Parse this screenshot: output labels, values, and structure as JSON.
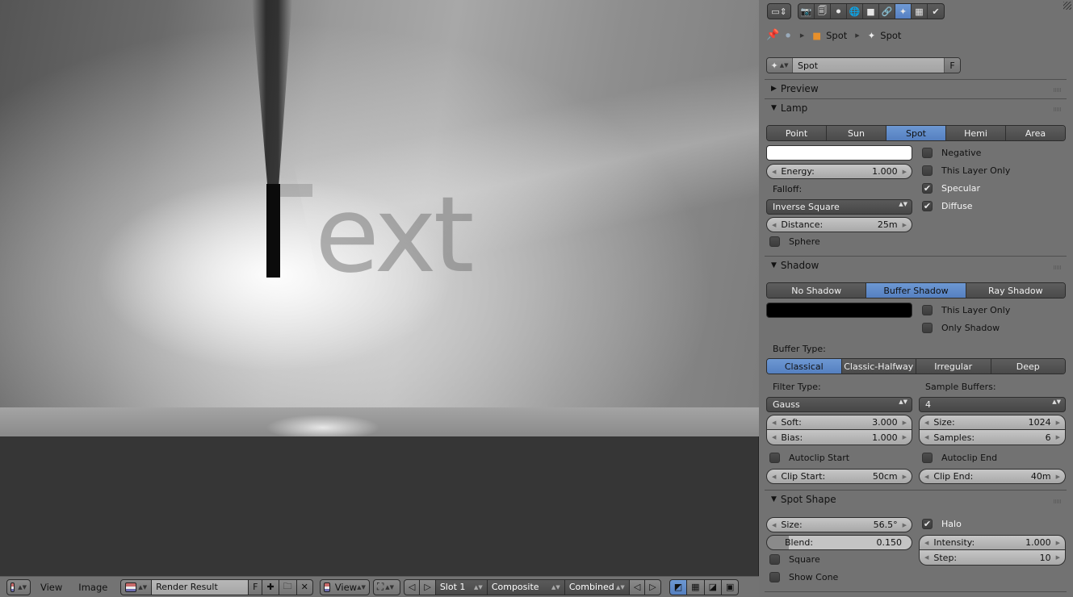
{
  "image_editor": {
    "render_text": "ext",
    "header": {
      "menus": [
        "View",
        "Image"
      ],
      "image_name": "Render Result",
      "fake_user_label": "F",
      "view_label": "View",
      "slot_label": "Slot 1",
      "layer_label": "Composite",
      "pass_label": "Combined"
    }
  },
  "properties": {
    "context_tabs": [
      {
        "name": "render",
        "glyph": "📷"
      },
      {
        "name": "render-layers",
        "glyph": "🗐"
      },
      {
        "name": "scene",
        "glyph": "⚫"
      },
      {
        "name": "world",
        "glyph": "🌐"
      },
      {
        "name": "object",
        "glyph": "■"
      },
      {
        "name": "constraints",
        "glyph": "🔗"
      },
      {
        "name": "data-lamp",
        "glyph": "✦",
        "active": true
      },
      {
        "name": "texture",
        "glyph": "▦"
      },
      {
        "name": "particles",
        "glyph": "✔"
      }
    ],
    "breadcrumb": {
      "object_name": "Spot",
      "lamp_name": "Spot"
    },
    "datablock": {
      "name": "Spot",
      "fake_user": "F"
    },
    "panels": {
      "preview": {
        "title": "Preview",
        "expanded": false
      },
      "lamp": {
        "title": "Lamp",
        "expanded": true,
        "types": [
          "Point",
          "Sun",
          "Spot",
          "Hemi",
          "Area"
        ],
        "selected_type": "Spot",
        "color": "#ffffff",
        "energy_label": "Energy:",
        "energy_value": "1.000",
        "falloff_label": "Falloff:",
        "falloff_value": "Inverse Square",
        "distance_label": "Distance:",
        "distance_value": "25m",
        "sphere_label": "Sphere",
        "sphere": false,
        "negative_label": "Negative",
        "negative": false,
        "this_layer_only_label": "This Layer Only",
        "this_layer_only": false,
        "specular_label": "Specular",
        "specular": true,
        "diffuse_label": "Diffuse",
        "diffuse": true
      },
      "shadow": {
        "title": "Shadow",
        "expanded": true,
        "modes": [
          "No Shadow",
          "Buffer Shadow",
          "Ray Shadow"
        ],
        "selected_mode": "Buffer Shadow",
        "color": "#000000",
        "this_layer_only_label": "This Layer Only",
        "this_layer_only": false,
        "only_shadow_label": "Only Shadow",
        "only_shadow": false,
        "buffer_type_label": "Buffer Type:",
        "buffer_types": [
          "Classical",
          "Classic-Halfway",
          "Irregular",
          "Deep"
        ],
        "selected_buffer_type": "Classical",
        "filter_type_label": "Filter Type:",
        "filter_type_value": "Gauss",
        "sample_buffers_label": "Sample Buffers:",
        "sample_buffers_value": "4",
        "soft_label": "Soft:",
        "soft_value": "3.000",
        "bias_label": "Bias:",
        "bias_value": "1.000",
        "size_label": "Size:",
        "size_value": "1024",
        "samples_label": "Samples:",
        "samples_value": "6",
        "autoclip_start_label": "Autoclip Start",
        "autoclip_start": false,
        "autoclip_end_label": "Autoclip End",
        "autoclip_end": false,
        "clip_start_label": "Clip Start:",
        "clip_start_value": "50cm",
        "clip_end_label": "Clip End:",
        "clip_end_value": "40m"
      },
      "spot_shape": {
        "title": "Spot Shape",
        "expanded": true,
        "size_label": "Size:",
        "size_value": "56.5°",
        "blend_label": "Blend:",
        "blend_value": "0.150",
        "blend_fraction": 0.15,
        "square_label": "Square",
        "square": false,
        "show_cone_label": "Show Cone",
        "show_cone": false,
        "halo_label": "Halo",
        "halo": true,
        "intensity_label": "Intensity:",
        "intensity_value": "1.000",
        "step_label": "Step:",
        "step_value": "10"
      }
    }
  }
}
